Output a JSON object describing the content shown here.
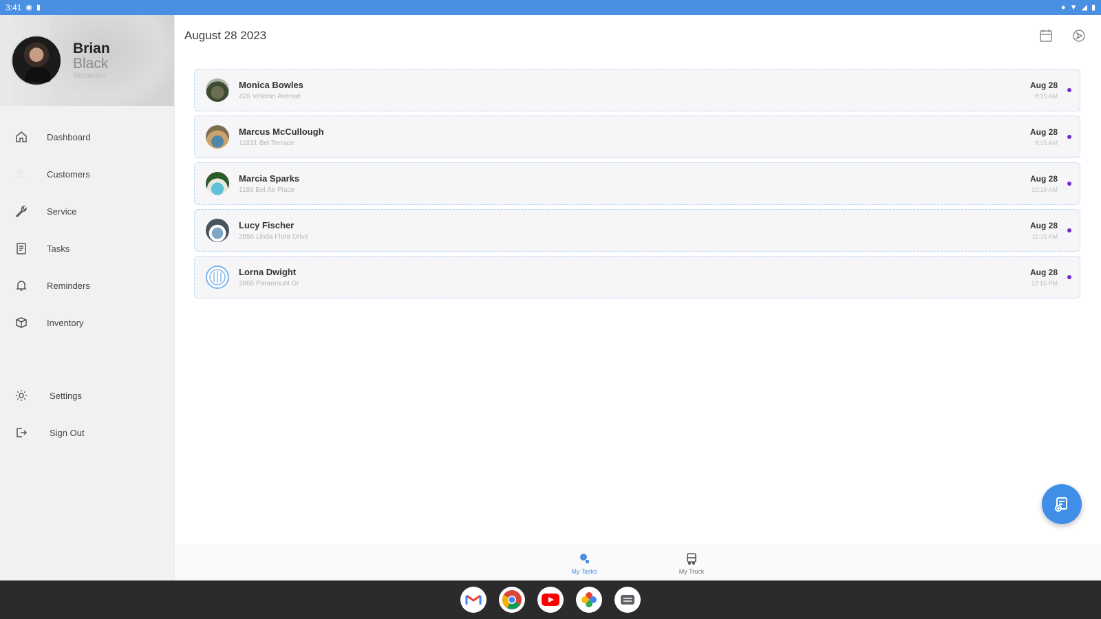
{
  "status_bar": {
    "time": "3:41"
  },
  "profile": {
    "first_name": "Brian",
    "last_name": "Black",
    "role": "Technician"
  },
  "nav": {
    "items": [
      {
        "label": "Dashboard",
        "icon": "home-icon"
      },
      {
        "label": "Customers",
        "icon": "customers-icon"
      },
      {
        "label": "Service",
        "icon": "wrench-icon"
      },
      {
        "label": "Tasks",
        "icon": "tasks-icon"
      },
      {
        "label": "Reminders",
        "icon": "bell-icon"
      },
      {
        "label": "Inventory",
        "icon": "box-icon"
      }
    ],
    "lower_items": [
      {
        "label": "Settings",
        "icon": "gear-icon"
      },
      {
        "label": "Sign Out",
        "icon": "sign-out-icon"
      }
    ]
  },
  "header": {
    "date": "August 28 2023",
    "actions": [
      "calendar-icon",
      "navigation-icon"
    ]
  },
  "tasks": [
    {
      "name": "Monica Bowles",
      "address": "426 Veteran Avenue",
      "date": "Aug 28",
      "time": "8:15 AM"
    },
    {
      "name": "Marcus McCullough",
      "address": "11831 Bel Terrace",
      "date": "Aug 28",
      "time": "9:15 AM"
    },
    {
      "name": "Marcia Sparks",
      "address": "1186 Bel Air Place",
      "date": "Aug 28",
      "time": "10:15 AM"
    },
    {
      "name": "Lucy Fischer",
      "address": "2856 Linda Flora Drive",
      "date": "Aug 28",
      "time": "11:15 AM"
    },
    {
      "name": "Lorna Dwight",
      "address": "2866 Paramount Dr",
      "date": "Aug 28",
      "time": "12:15 PM"
    }
  ],
  "bottom_tabs": [
    {
      "label": "My Tasks",
      "icon": "tasks-tab-icon",
      "active": true
    },
    {
      "label": "My Truck",
      "icon": "truck-icon",
      "active": false
    }
  ],
  "colors": {
    "accent": "#4a90e2",
    "status_dot": "#6f2cd0",
    "card_border": "#b6d4f4"
  },
  "dock_apps": [
    "gmail-icon",
    "chrome-icon",
    "youtube-icon",
    "photos-icon",
    "messages-icon"
  ]
}
